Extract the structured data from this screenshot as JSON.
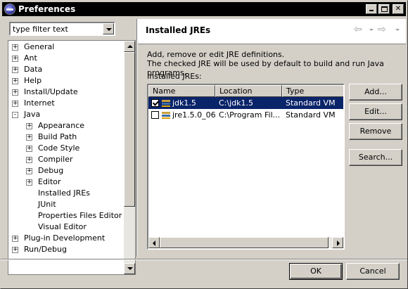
{
  "window": {
    "title": "Preferences"
  },
  "filter": {
    "value": "type filter text"
  },
  "tree": {
    "items": [
      {
        "label": "General",
        "level": 0,
        "expander": "+"
      },
      {
        "label": "Ant",
        "level": 0,
        "expander": "+"
      },
      {
        "label": "Data",
        "level": 0,
        "expander": "+"
      },
      {
        "label": "Help",
        "level": 0,
        "expander": "+"
      },
      {
        "label": "Install/Update",
        "level": 0,
        "expander": "+"
      },
      {
        "label": "Internet",
        "level": 0,
        "expander": "+"
      },
      {
        "label": "Java",
        "level": 0,
        "expander": "-"
      },
      {
        "label": "Appearance",
        "level": 1,
        "expander": "+"
      },
      {
        "label": "Build Path",
        "level": 1,
        "expander": "+"
      },
      {
        "label": "Code Style",
        "level": 1,
        "expander": "+"
      },
      {
        "label": "Compiler",
        "level": 1,
        "expander": "+"
      },
      {
        "label": "Debug",
        "level": 1,
        "expander": "+"
      },
      {
        "label": "Editor",
        "level": 1,
        "expander": "+"
      },
      {
        "label": "Installed JREs",
        "level": 1,
        "expander": ""
      },
      {
        "label": "JUnit",
        "level": 1,
        "expander": ""
      },
      {
        "label": "Properties Files Editor",
        "level": 1,
        "expander": ""
      },
      {
        "label": "Visual Editor",
        "level": 1,
        "expander": ""
      },
      {
        "label": "Plug-in Development",
        "level": 0,
        "expander": "+"
      },
      {
        "label": "Run/Debug",
        "level": 0,
        "expander": "+"
      }
    ]
  },
  "page": {
    "title": "Installed JREs",
    "description_line1": "Add, remove or edit JRE definitions.",
    "description_line2": "The checked JRE will be used by default to build and run Java programs.",
    "installed_label": "Installed JREs:"
  },
  "table": {
    "columns": [
      "Name",
      "Location",
      "Type"
    ],
    "rows": [
      {
        "name": "jdk1.5",
        "location": "C:\\jdk1.5",
        "type": "Standard VM",
        "checked": true,
        "selected": true
      },
      {
        "name": "jre1.5.0_06",
        "location": "C:\\Program Fil...",
        "type": "Standard VM",
        "checked": false,
        "selected": false
      }
    ]
  },
  "actions": {
    "add": "Add...",
    "edit": "Edit...",
    "remove": "Remove",
    "search": "Search..."
  },
  "dialog": {
    "ok": "OK",
    "cancel": "Cancel"
  },
  "colors": {
    "selection": "#0a246a",
    "face": "#d4d0c8"
  }
}
